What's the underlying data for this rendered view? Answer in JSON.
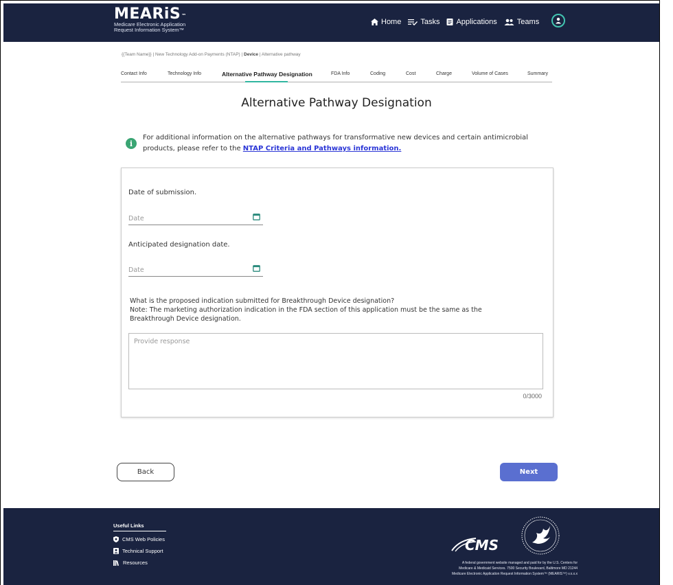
{
  "header": {
    "logo_title": "MEARiS",
    "logo_tm": "™",
    "logo_sub_line1": "Medicare Electronic Application",
    "logo_sub_line2": "Request Information System™",
    "nav": {
      "home": "Home",
      "tasks": "Tasks",
      "applications": "Applications",
      "teams": "Teams"
    }
  },
  "breadcrumb": {
    "prefix": "{{Team Name}} | New Technology Add-on Payments (NTAP) | ",
    "current": "Device",
    "suffix": " | Alternative pathway"
  },
  "tabs": [
    {
      "label": "Contact Info"
    },
    {
      "label": "Technology Info"
    },
    {
      "label": "Alternative Pathway Designation"
    },
    {
      "label": "FDA Info"
    },
    {
      "label": "Coding"
    },
    {
      "label": "Cost"
    },
    {
      "label": "Charge"
    },
    {
      "label": "Volume of Cases"
    },
    {
      "label": "Summary"
    }
  ],
  "page_title": "Alternative Pathway Designation",
  "info": {
    "icon": "i",
    "text": "For additional information on the alternative pathways for transformative new devices and certain antimicrobial products, please refer to the ",
    "link": "NTAP Criteria and Pathways information."
  },
  "form": {
    "submission_label": "Date of submission.",
    "submission_placeholder": "Date",
    "designation_label": "Anticipated designation date.",
    "designation_placeholder": "Date",
    "question_line1": "What is the proposed indication submitted for Breakthrough Device designation?",
    "question_line2": "Note: The marketing authorization indication in the FDA section of this application must be the same as the Breakthrough Device designation.",
    "response_placeholder": "Provide response",
    "counter": "0/3000"
  },
  "buttons": {
    "back": "Back",
    "next": "Next"
  },
  "footer": {
    "useful_links": "Useful Links",
    "links": [
      "CMS Web Policies",
      "Technical Support",
      "Resources"
    ],
    "cms_logo_text": "CMS",
    "disclaimer_line1": "A federal government website managed and paid for by the U.S. Centers for",
    "disclaimer_line2": "Medicare & Medicaid Services. 7500 Security Boulevard, Baltimore MD 21244",
    "disclaimer_line3": "Medicare Electronic Application Request Information System™ (MEARIS™) v.x.x.x"
  },
  "colors": {
    "header_bg": "#1a2340",
    "accent_teal": "#2fb59f",
    "next_button": "#5a6fd0",
    "link": "#2a35d6",
    "info_green": "#3aa573"
  }
}
